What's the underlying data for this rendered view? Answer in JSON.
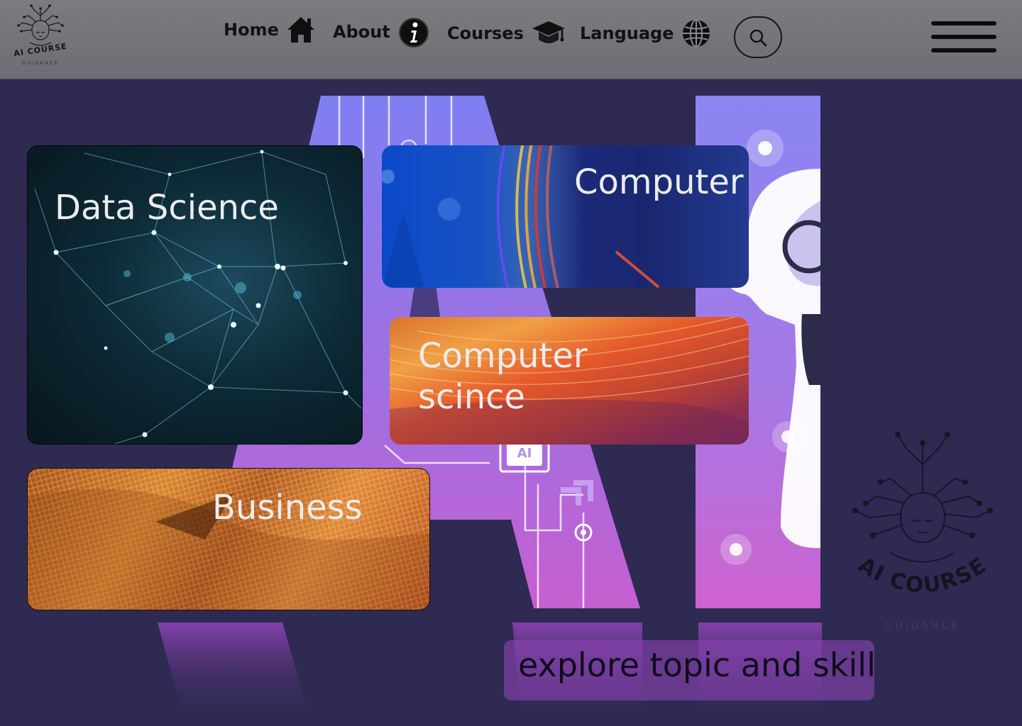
{
  "brand": {
    "logo_text": "AI COURSE",
    "logo_subtext": "GUIDANCE"
  },
  "nav": {
    "items": [
      {
        "label": "Home",
        "icon": "home-icon"
      },
      {
        "label": "About",
        "icon": "info-icon"
      },
      {
        "label": "Courses",
        "icon": "graduation-cap-icon"
      },
      {
        "label": "Language",
        "icon": "globe-icon"
      }
    ],
    "search_icon": "search-icon",
    "menu_icon": "hamburger-menu-icon"
  },
  "hero": {
    "background_text": "AI",
    "chip_text": "AI"
  },
  "cards": [
    {
      "label": "Data Science"
    },
    {
      "label": "Computer"
    },
    {
      "label_line1": "Computer",
      "label_line2": "scince"
    },
    {
      "label": "Business"
    }
  ],
  "tagline": "explore topic and skill",
  "colors": {
    "page_background": "#2e2a52",
    "header_background": "#76737b",
    "hero_accent": "#8f7bf0",
    "tagline_box": "#8a44b8"
  }
}
